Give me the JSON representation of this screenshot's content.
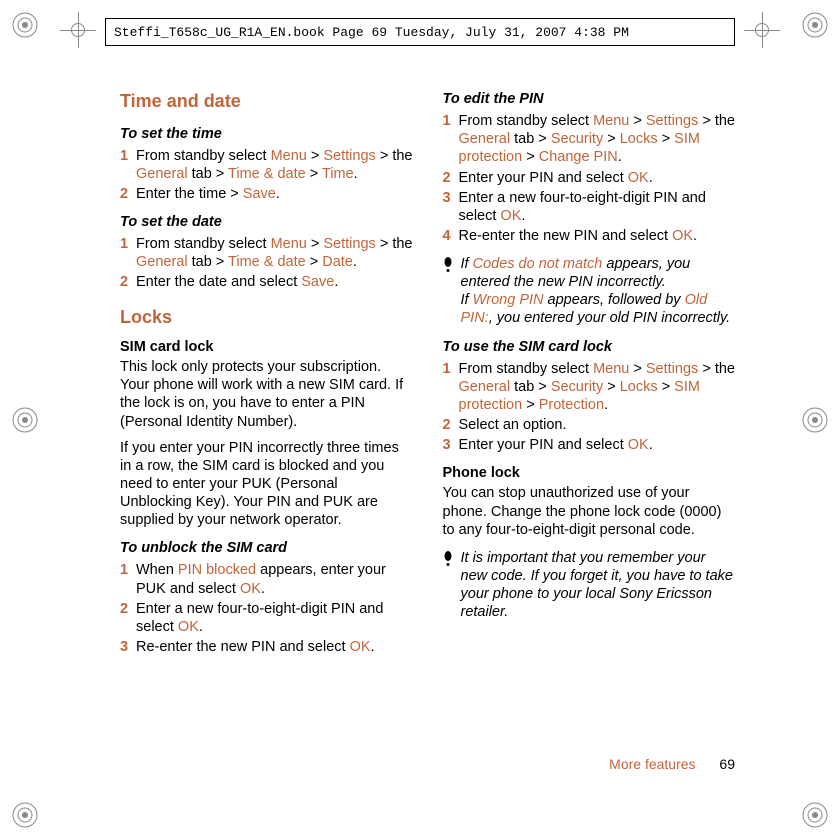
{
  "header": {
    "doc_info": "Steffi_T658c_UG_R1A_EN.book  Page 69  Tuesday, July 31, 2007  4:38 PM"
  },
  "footer": {
    "section": "More features",
    "page": "69"
  },
  "left": {
    "h_time": "Time and date",
    "s_set_time": "To set the time",
    "set_time_1_a": "From standby select ",
    "set_time_1_menu": "Menu",
    "set_time_1_b": " > ",
    "set_time_1_settings": "Settings",
    "set_time_1_c": " > the ",
    "set_time_1_general": "General",
    "set_time_1_d": " tab > ",
    "set_time_1_td": "Time & date",
    "set_time_1_e": " > ",
    "set_time_1_time": "Time",
    "set_time_1_f": ".",
    "set_time_2_a": "Enter the time > ",
    "set_time_2_save": "Save",
    "set_time_2_b": ".",
    "s_set_date": "To set the date",
    "set_date_1_a": "From standby select ",
    "set_date_1_menu": "Menu",
    "set_date_1_b": " > ",
    "set_date_1_settings": "Settings",
    "set_date_1_c": " > the ",
    "set_date_1_general": "General",
    "set_date_1_d": " tab > ",
    "set_date_1_td": "Time & date",
    "set_date_1_e": " > ",
    "set_date_1_date": "Date",
    "set_date_1_f": ".",
    "set_date_2_a": "Enter the date and select ",
    "set_date_2_save": "Save",
    "set_date_2_b": ".",
    "h_locks": "Locks",
    "sim_h": "SIM card lock",
    "sim_p1": "This lock only protects your subscription. Your phone will work with a new SIM card. If the lock is on, you have to enter a PIN (Personal Identity Number).",
    "sim_p2": "If you enter your PIN incorrectly three times in a row, the SIM card is blocked and you need to enter your PUK (Personal Unblocking Key). Your PIN and PUK are supplied by your network operator.",
    "s_unblock": "To unblock the SIM card",
    "ub_1_a": "When ",
    "ub_1_pb": "PIN blocked",
    "ub_1_b": " appears, enter your PUK and select ",
    "ub_1_ok": "OK",
    "ub_1_c": ".",
    "ub_2_a": "Enter a new four-to-eight-digit PIN and select ",
    "ub_2_ok": "OK",
    "ub_2_b": ".",
    "ub_3_a": "Re-enter the new PIN and select ",
    "ub_3_ok": "OK",
    "ub_3_b": "."
  },
  "right": {
    "s_edit": "To edit the PIN",
    "ed_1_a": "From standby select ",
    "ed_1_menu": "Menu",
    "ed_1_b": " > ",
    "ed_1_settings": "Settings",
    "ed_1_c": " > the ",
    "ed_1_general": "General",
    "ed_1_d": " tab > ",
    "ed_1_sec": "Security",
    "ed_1_e": " > ",
    "ed_1_locks": "Locks",
    "ed_1_f": " > ",
    "ed_1_sim": "SIM protection",
    "ed_1_g": " > ",
    "ed_1_chpin": "Change PIN",
    "ed_1_h": ".",
    "ed_2_a": "Enter your PIN and select ",
    "ed_2_ok": "OK",
    "ed_2_b": ".",
    "ed_3_a": "Enter a new four-to-eight-digit PIN and select ",
    "ed_3_ok": "OK",
    "ed_3_b": ".",
    "ed_4_a": "Re-enter the new PIN and select ",
    "ed_4_ok": "OK",
    "ed_4_b": ".",
    "tip1_a": "If ",
    "tip1_codes": "Codes do not match",
    "tip1_b": " appears, you entered the new PIN incorrectly.",
    "tip1_c": "If ",
    "tip1_wrong": "Wrong PIN",
    "tip1_d": " appears, followed by ",
    "tip1_old": "Old PIN:",
    "tip1_e": ", you entered your old PIN incorrectly.",
    "s_use": "To use the SIM card lock",
    "us_1_a": "From standby select ",
    "us_1_menu": "Menu",
    "us_1_b": " > ",
    "us_1_settings": "Settings",
    "us_1_c": " > the ",
    "us_1_general": "General",
    "us_1_d": " tab > ",
    "us_1_sec": "Security",
    "us_1_e": " > ",
    "us_1_locks": "Locks",
    "us_1_f": " > ",
    "us_1_sim": "SIM protection",
    "us_1_g": " > ",
    "us_1_prot": "Protection",
    "us_1_h": ".",
    "us_2": "Select an option.",
    "us_3_a": "Enter your PIN and select ",
    "us_3_ok": "OK",
    "us_3_b": ".",
    "phone_h": "Phone lock",
    "phone_p": "You can stop unauthorized use of your phone. Change the phone lock code (0000) to any four-to-eight-digit personal code.",
    "tip2": "It is important that you remember your new code. If you forget it, you have to take your phone to your local Sony Ericsson retailer."
  },
  "nums": {
    "1": "1",
    "2": "2",
    "3": "3",
    "4": "4"
  }
}
